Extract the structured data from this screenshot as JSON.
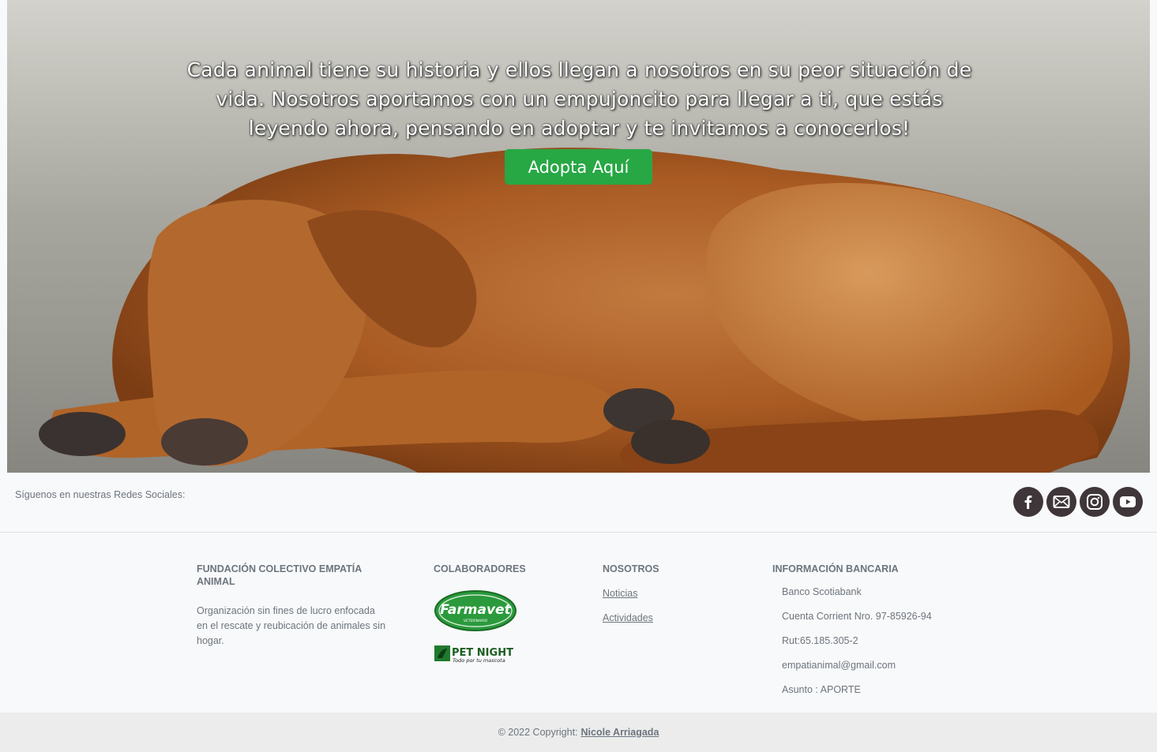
{
  "hero": {
    "text": "Cada animal tiene su historia y ellos llegan a nosotros en su peor situación de vida. Nosotros aportamos con un empujoncito para llegar a ti, que estás leyendo ahora, pensando en adoptar y te invitamos a conocerlos!",
    "button_label": "Adopta Aquí"
  },
  "social": {
    "label": "Síguenos en nuestras Redes Sociales:",
    "icons": [
      "facebook-icon",
      "mail-icon",
      "instagram-icon",
      "youtube-icon"
    ]
  },
  "footer": {
    "about": {
      "heading": "FUNDACIÓN COLECTIVO EMPATÍA ANIMAL",
      "text": "Organización sin fines de lucro enfocada en el rescate y reubicación de animales sin hogar."
    },
    "partners": {
      "heading": "COLABORADORES",
      "farmavet": "Farmavet",
      "farmavet_sub": "VETERINARIO",
      "petnight": "PET NIGHT",
      "petnight_sub": "Todo por tu mascota"
    },
    "nosotros": {
      "heading": "NOSOTROS",
      "links": [
        "Noticias",
        "Actividades"
      ]
    },
    "bank": {
      "heading": "INFORMACIÓN BANCARIA",
      "lines": [
        "Banco Scotiabank",
        "Cuenta Corrient Nro. 97-85926-94",
        "Rut:65.185.305-2",
        "empatianimal@gmail.com",
        "Asunto : APORTE"
      ]
    }
  },
  "copyright": {
    "text": "© 2022 Copyright:",
    "author": "Nicole Arriagada"
  },
  "colors": {
    "accent_green": "#28a745",
    "social_icon_bg": "#3f3639",
    "footer_bg": "#f8f9fa",
    "copyright_bg": "#ececec",
    "dog_fur": "#b8652a"
  }
}
